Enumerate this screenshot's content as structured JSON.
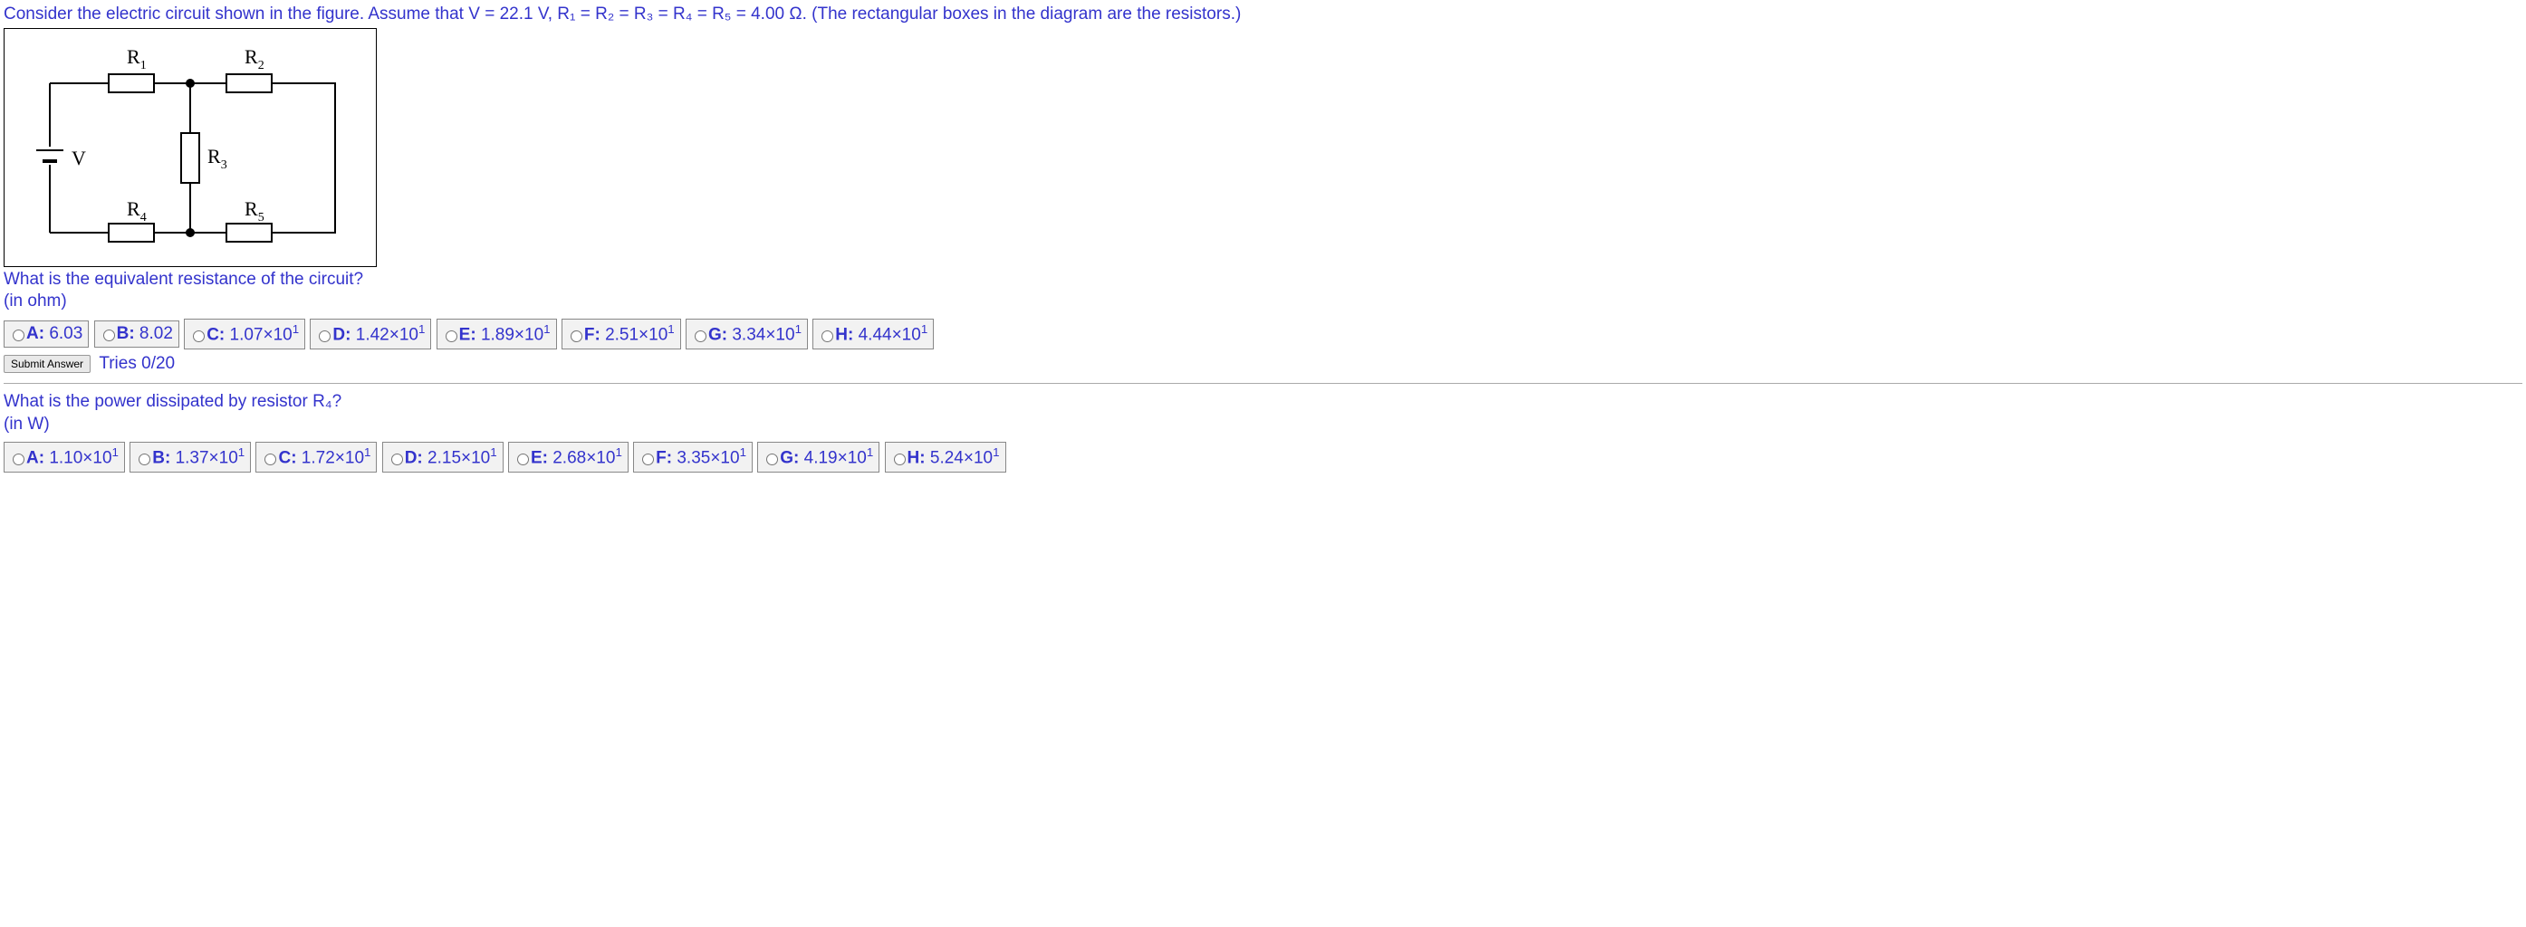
{
  "problem_text": "Consider the electric circuit shown in the figure. Assume that V = 22.1 V, R₁ = R₂ = R₃ = R₄ = R₅ = 4.00 Ω. (The rectangular boxes in the diagram are the resistors.)",
  "diagram": {
    "labels": {
      "R1": "R",
      "R1sub": "1",
      "R2": "R",
      "R2sub": "2",
      "R3": "R",
      "R3sub": "3",
      "R4": "R",
      "R4sub": "4",
      "R5": "R",
      "R5sub": "5",
      "V": "V"
    }
  },
  "q1": {
    "text1": "What is the equivalent resistance of the circuit?",
    "text2": "(in ohm)",
    "choices": [
      {
        "letter": "A",
        "value": "6.03"
      },
      {
        "letter": "B",
        "value": "8.02"
      },
      {
        "letter": "C",
        "value": "1.07×10",
        "sup": "1"
      },
      {
        "letter": "D",
        "value": "1.42×10",
        "sup": "1"
      },
      {
        "letter": "E",
        "value": "1.89×10",
        "sup": "1"
      },
      {
        "letter": "F",
        "value": "2.51×10",
        "sup": "1"
      },
      {
        "letter": "G",
        "value": "3.34×10",
        "sup": "1"
      },
      {
        "letter": "H",
        "value": "4.44×10",
        "sup": "1"
      }
    ],
    "submit_label": "Submit Answer",
    "tries": "Tries 0/20"
  },
  "q2": {
    "text1": "What is the power dissipated by resistor R₄?",
    "text2": "(in W)",
    "choices": [
      {
        "letter": "A",
        "value": "1.10×10",
        "sup": "1"
      },
      {
        "letter": "B",
        "value": "1.37×10",
        "sup": "1"
      },
      {
        "letter": "C",
        "value": "1.72×10",
        "sup": "1"
      },
      {
        "letter": "D",
        "value": "2.15×10",
        "sup": "1"
      },
      {
        "letter": "E",
        "value": "2.68×10",
        "sup": "1"
      },
      {
        "letter": "F",
        "value": "3.35×10",
        "sup": "1"
      },
      {
        "letter": "G",
        "value": "4.19×10",
        "sup": "1"
      },
      {
        "letter": "H",
        "value": "5.24×10",
        "sup": "1"
      }
    ]
  }
}
